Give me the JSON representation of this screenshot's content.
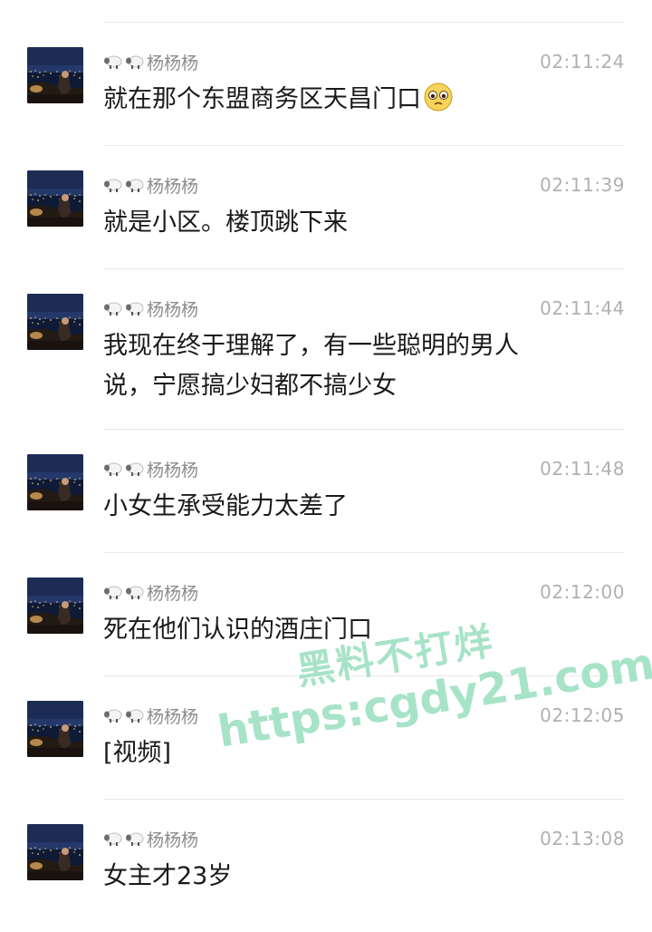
{
  "messages": [
    {
      "sender": "🐑🐑杨杨杨",
      "sender_name": "杨杨杨",
      "time": "02:11:24",
      "text": "就在那个东盟商务区天昌门口",
      "emoji": "pleading-face-icon"
    },
    {
      "sender": "🐑🐑杨杨杨",
      "sender_name": "杨杨杨",
      "time": "02:11:39",
      "text": "就是小区。楼顶跳下来"
    },
    {
      "sender": "🐑🐑杨杨杨",
      "sender_name": "杨杨杨",
      "time": "02:11:44",
      "text_line1": "我现在终于理解了，有一些聪明的男人",
      "text_line2": "说，宁愿搞少妇都不搞少女"
    },
    {
      "sender": "🐑🐑杨杨杨",
      "sender_name": "杨杨杨",
      "time": "02:11:48",
      "text": "小女生承受能力太差了"
    },
    {
      "sender": "🐑🐑杨杨杨",
      "sender_name": "杨杨杨",
      "time": "02:12:00",
      "text": "死在他们认识的酒庄门口"
    },
    {
      "sender": "🐑🐑杨杨杨",
      "sender_name": "杨杨杨",
      "time": "02:12:05",
      "text": "[视频]"
    },
    {
      "sender": "🐑🐑杨杨杨",
      "sender_name": "杨杨杨",
      "time": "02:13:08",
      "text": "女主才23岁"
    }
  ],
  "watermark": {
    "line1": "黑料不打烊",
    "line2": "https:cgdy21.com",
    "color": "#9ee0c2"
  },
  "colors": {
    "name": "#8c8c8c",
    "time": "#b0b0b0",
    "text": "#1a1a1a",
    "divider": "#e9e9e9"
  }
}
